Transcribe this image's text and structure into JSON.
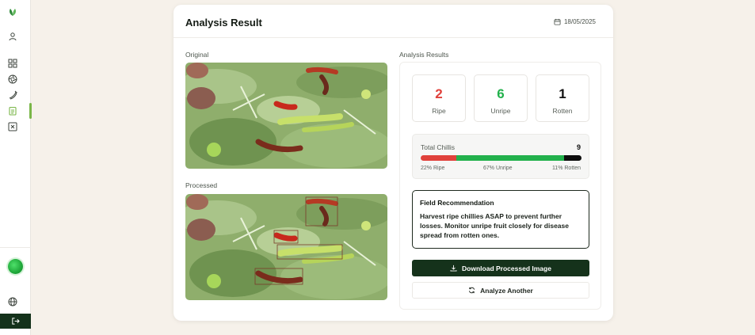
{
  "sidebar": {
    "logo_icon": "leaf-icon",
    "items": [
      {
        "icon": "user-icon",
        "active": false
      },
      {
        "icon": "dashboard-icon",
        "active": false
      },
      {
        "icon": "aperture-icon",
        "active": false
      },
      {
        "icon": "chili-icon",
        "active": false
      },
      {
        "icon": "clipboard-icon",
        "active": true
      },
      {
        "icon": "close-square-icon",
        "active": false
      }
    ],
    "bottom": [
      {
        "icon": "globe-icon"
      },
      {
        "icon": "logout-icon"
      }
    ],
    "accent_color": "#7ab648"
  },
  "header": {
    "title": "Analysis Result",
    "date": "18/05/2025"
  },
  "images": {
    "original_label": "Original",
    "processed_label": "Processed"
  },
  "results": {
    "section_label": "Analysis Results",
    "stats": [
      {
        "value": "2",
        "label": "Ripe",
        "color": "#e0413b"
      },
      {
        "value": "6",
        "label": "Unripe",
        "color": "#22b14c"
      },
      {
        "value": "1",
        "label": "Rotten",
        "color": "#111111"
      }
    ],
    "total": {
      "label": "Total Chillis",
      "value": "9",
      "ripe_pct": "22% Ripe",
      "unripe_pct": "67% Unripe",
      "rotten_pct": "11% Rotten",
      "ripe_fraction": 0.22,
      "unripe_fraction": 0.67,
      "rotten_fraction": 0.11
    },
    "recommendation": {
      "title": "Field Recommendation",
      "text": "Harvest ripe chillies ASAP to prevent further losses. Monitor unripe fruit closely for disease spread from rotten ones."
    },
    "download_label": "Download Processed Image",
    "analyze_label": "Analyze Another"
  }
}
